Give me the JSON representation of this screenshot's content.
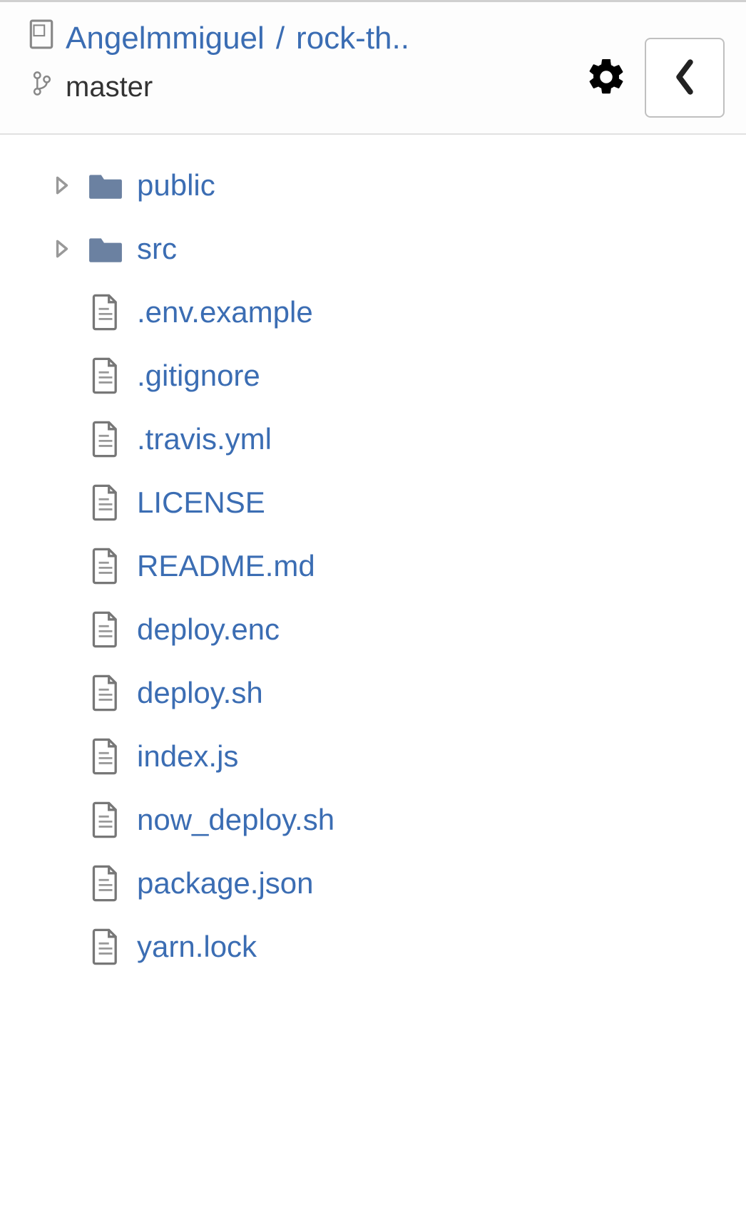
{
  "header": {
    "owner": "Angelmmiguel",
    "separator": "/",
    "repo": "rock-th..",
    "branch": "master"
  },
  "tree": [
    {
      "type": "folder",
      "name": "public"
    },
    {
      "type": "folder",
      "name": "src"
    },
    {
      "type": "file",
      "name": ".env.example"
    },
    {
      "type": "file",
      "name": ".gitignore"
    },
    {
      "type": "file",
      "name": ".travis.yml"
    },
    {
      "type": "file",
      "name": "LICENSE"
    },
    {
      "type": "file",
      "name": "README.md"
    },
    {
      "type": "file",
      "name": "deploy.enc"
    },
    {
      "type": "file",
      "name": "deploy.sh"
    },
    {
      "type": "file",
      "name": "index.js"
    },
    {
      "type": "file",
      "name": "now_deploy.sh"
    },
    {
      "type": "file",
      "name": "package.json"
    },
    {
      "type": "file",
      "name": "yarn.lock"
    }
  ]
}
